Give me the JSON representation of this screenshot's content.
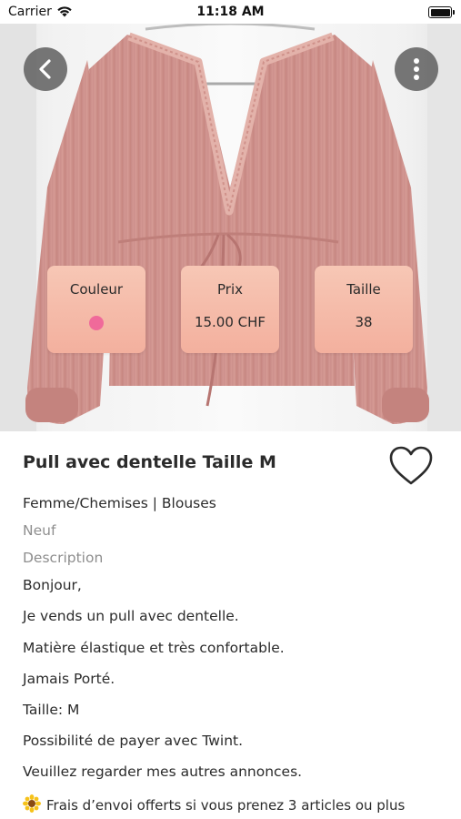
{
  "status_bar": {
    "carrier": "Carrier",
    "time": "11:18 AM"
  },
  "product": {
    "attributes": {
      "color_label": "Couleur",
      "color_value": "#f06a9a",
      "price_label": "Prix",
      "price_value": "15.00 CHF",
      "size_label": "Taille",
      "size_value": "38"
    },
    "title": "Pull avec dentelle Taille M",
    "category": "Femme/Chemises | Blouses",
    "condition": "Neuf",
    "description_label": "Description",
    "description_lines": [
      "Bonjour,",
      "Je vends un pull avec dentelle.",
      "Matière élastique et très confortable.",
      "Jamais Porté.",
      "Taille: M",
      "Possibilité de payer avec Twint.",
      "Veuillez regarder mes autres annonces.",
      "Frais d’envoi offerts si vous prenez 3 articles ou plus"
    ]
  },
  "icons": {
    "back": "chevron-left-icon",
    "more": "more-vertical-icon",
    "favorite": "heart-outline-icon",
    "flower": "sunflower-emoji-icon"
  },
  "colors": {
    "card_background": "#f5bba8",
    "button_background": "#5f5f5f",
    "text_primary": "#2b2b2b",
    "text_muted": "#8e8e8e"
  }
}
